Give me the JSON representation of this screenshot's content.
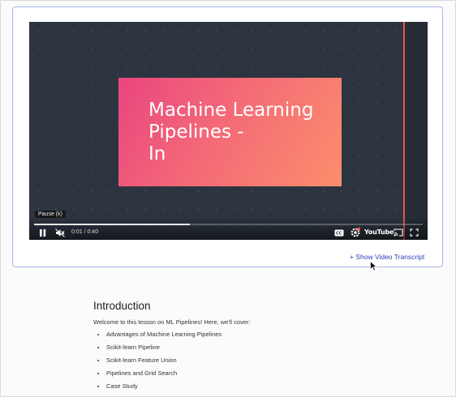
{
  "video": {
    "slide_title": "Machine Learning\nPipelines -\nIn",
    "tooltip": "Pause (k)",
    "time": "0:01 / 0:40",
    "progress": 0.4,
    "youtube_label": "YouTube",
    "icons": [
      "pause-icon",
      "mute-icon",
      "captions-icon",
      "settings-icon",
      "cast-icon",
      "fullscreen-icon"
    ]
  },
  "transcript": {
    "link_label": "+ Show Video Transcript"
  },
  "content": {
    "heading": "Introduction",
    "welcome": "Welcome to this lesson on ML Pipelines! Here, we'll cover:",
    "topics": [
      "Advantages of Machine Learning Pipelines",
      "Scikit-learn Pipeline",
      "Scikit-learn Feature Union",
      "Pipelines and Grid Search",
      "Case Study"
    ]
  },
  "colors": {
    "accent_link": "#3340b8",
    "slide_pink": "#e9457f",
    "slide_orange": "#fb8e6c",
    "progress_red": "#e8554f"
  }
}
